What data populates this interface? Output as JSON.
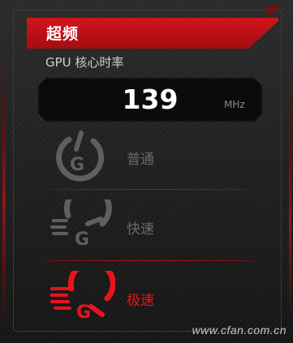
{
  "panel": {
    "title": "超频",
    "gpu_label": "GPU 核心时率",
    "display": {
      "value": "139",
      "unit": "MHz"
    }
  },
  "modes": [
    {
      "label": "普通",
      "icon": "gauge-normal-icon",
      "active": false
    },
    {
      "label": "快速",
      "icon": "gauge-fast-icon",
      "active": false
    },
    {
      "label": "极速",
      "icon": "gauge-extreme-icon",
      "active": true
    }
  ],
  "colors": {
    "accent": "#d4141a",
    "active_text": "#e8141c",
    "inactive": "#6a6a6a"
  },
  "watermark": "www.cfan.com.cn"
}
